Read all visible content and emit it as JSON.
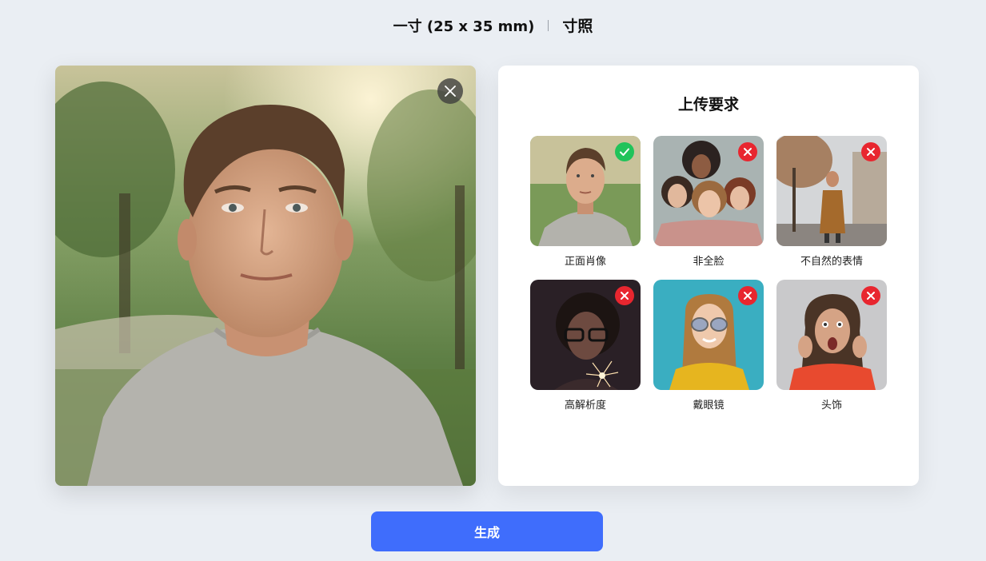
{
  "header": {
    "size_label": "一寸 (25 x 35 mm)",
    "type_label": "寸照"
  },
  "photo": {
    "close_icon": "close-icon"
  },
  "requirements": {
    "title": "上传要求",
    "items": [
      {
        "label": "正面肖像",
        "status": "ok",
        "icon": "check-icon"
      },
      {
        "label": "非全脸",
        "status": "bad",
        "icon": "x-icon"
      },
      {
        "label": "不自然的表情",
        "status": "bad",
        "icon": "x-icon"
      },
      {
        "label": "高解析度",
        "status": "bad",
        "icon": "x-icon"
      },
      {
        "label": "戴眼镜",
        "status": "bad",
        "icon": "x-icon"
      },
      {
        "label": "头饰",
        "status": "bad",
        "icon": "x-icon"
      }
    ]
  },
  "actions": {
    "generate_label": "生成"
  },
  "colors": {
    "accent": "#3f6dfc",
    "ok": "#20c35a",
    "bad": "#e8262f",
    "background": "#eaeef3"
  }
}
